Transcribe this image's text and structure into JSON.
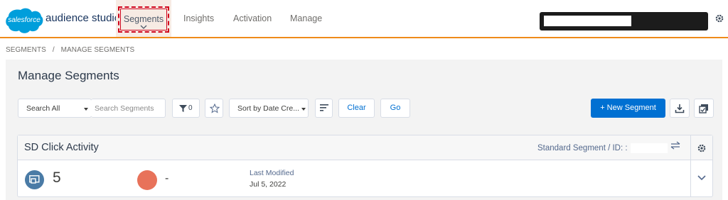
{
  "brand": {
    "logo_text": "salesforce",
    "product": "audience studio",
    "accent_color": "#ef8b1a"
  },
  "nav": {
    "tabs": [
      {
        "label": "Segments",
        "active": true
      },
      {
        "label": "Insights",
        "active": false
      },
      {
        "label": "Activation",
        "active": false
      },
      {
        "label": "Manage",
        "active": false
      }
    ]
  },
  "breadcrumb": {
    "root": "SEGMENTS",
    "separator": "/",
    "current": "MANAGE SEGMENTS"
  },
  "page": {
    "title": "Manage Segments"
  },
  "toolbar": {
    "scope_select": "Search All",
    "search_placeholder": "Search Segments",
    "filter_count": "0",
    "sort_select": "Sort by Date Cre...",
    "clear_label": "Clear",
    "go_label": "Go",
    "new_segment_label": "+ New Segment"
  },
  "segment": {
    "name": "SD Click Activity",
    "type_id": "Standard Segment / ID: :",
    "count": "5",
    "status_value": "-",
    "status_color": "#e8725a",
    "last_modified_label": "Last Modified",
    "last_modified_date": "Jul 5, 2022"
  },
  "icons": [
    "cloud-logo",
    "chevron-down-icon",
    "gear-icon",
    "filter-icon",
    "star-icon",
    "sort-lines-icon",
    "download-icon",
    "bulk-edit-icon",
    "swap-icon",
    "segment-icon"
  ]
}
